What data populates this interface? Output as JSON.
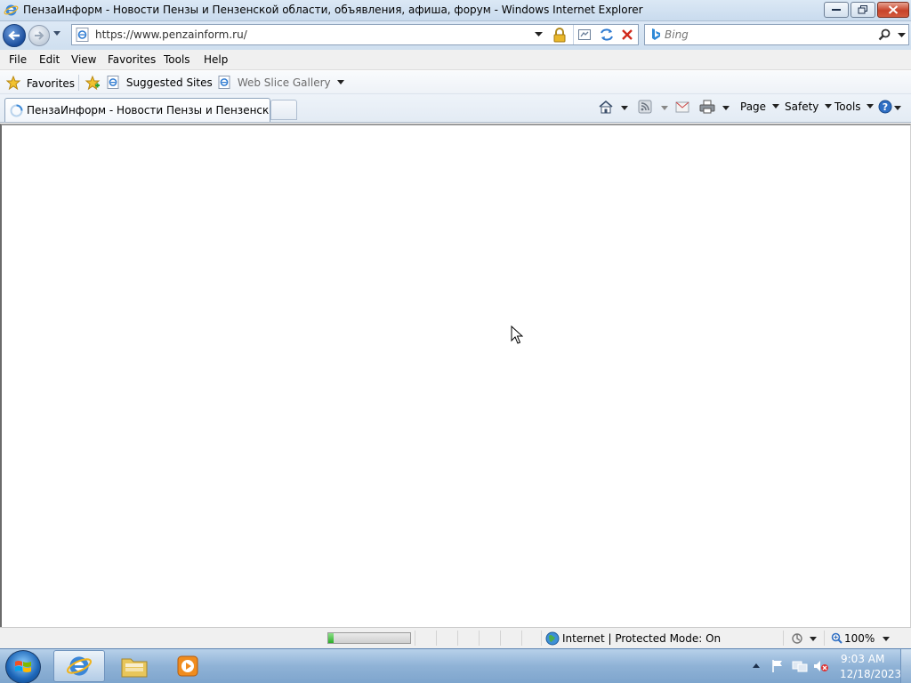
{
  "window": {
    "title": "ПензаИнформ - Новости Пензы и Пензенской области, объявления, афиша, форум - Windows Internet Explorer"
  },
  "address_bar": {
    "url": "https://www.penzainform.ru/"
  },
  "search": {
    "placeholder": "Bing"
  },
  "menu": {
    "items": [
      "File",
      "Edit",
      "View",
      "Favorites",
      "Tools",
      "Help"
    ]
  },
  "favorites_bar": {
    "favorites_label": "Favorites",
    "suggested_sites": "Suggested Sites",
    "web_slice_gallery": "Web Slice Gallery"
  },
  "tabs": [
    {
      "title": "ПензаИнформ - Новости Пензы и Пензенской ..."
    }
  ],
  "command_bar": {
    "page": "Page",
    "safety": "Safety",
    "tools": "Tools"
  },
  "status_bar": {
    "progress_fraction": 0.06,
    "zone": "Internet | Protected Mode: On",
    "zoom": "100%"
  },
  "taskbar": {
    "time": "9:03 AM",
    "date": "12/18/2023"
  },
  "icons": {
    "browser": "internet-explorer-icon",
    "back": "back-arrow-icon",
    "forward": "forward-arrow-icon",
    "lock": "lock-icon",
    "refresh": "refresh-icon",
    "stop": "stop-icon",
    "search": "magnifier-icon",
    "home": "home-icon",
    "feeds": "rss-icon",
    "mail": "mail-icon",
    "print": "printer-icon",
    "help": "help-icon"
  },
  "colors": {
    "titlebar": "#c9dbee",
    "close_button": "#c7432a",
    "taskbar": "#8fb2d6",
    "progress_fill": "#2cae2a"
  }
}
